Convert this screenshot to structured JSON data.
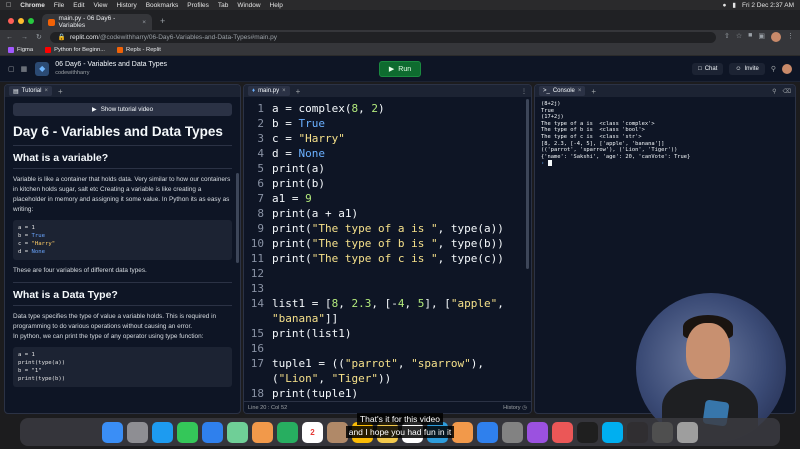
{
  "menubar": {
    "apple": "",
    "app": "Chrome",
    "items": [
      "File",
      "Edit",
      "View",
      "History",
      "Bookmarks",
      "Profiles",
      "Tab",
      "Window",
      "Help"
    ],
    "datetime": "Fri 2 Dec  2:37 AM"
  },
  "browser": {
    "tab_title": "main.py - 06 Day6 - Variables",
    "tab_close": "×",
    "new_tab": "+",
    "url_host": "replit.com",
    "url_path": "/@codewithharry/06-Day6-Variables-and-Data-Types#main.py"
  },
  "bookmarks": [
    {
      "label": "Figma",
      "color": "#a259ff"
    },
    {
      "label": "Python for Beginn...",
      "color": "#ff0000"
    },
    {
      "label": "Repls - Replit",
      "color": "#f26207"
    }
  ],
  "replit": {
    "project_title": "06 Day6 - Variables and Data Types",
    "owner": "codewithharry",
    "run_label": "Run",
    "chat_label": "Chat",
    "invite_label": "Invite"
  },
  "tutorial": {
    "tab_label": "Tutorial",
    "show_video": "Show tutorial video",
    "title": "Day 6 - Variables and Data Types",
    "h_variable": "What is a variable?",
    "p_variable": "Variable is like a container that holds data. Very similar to how our containers in kitchen holds sugar, salt etc Creating a variable is like creating a placeholder in memory and assigning it some value. In Python its as easy as writing:",
    "code1": [
      {
        "a": "a = ",
        "b": "1",
        "t": "num"
      },
      {
        "a": "b = ",
        "b": "True",
        "t": "kw"
      },
      {
        "a": "c = ",
        "b": "\"Harry\"",
        "t": "str"
      },
      {
        "a": "d = ",
        "b": "None",
        "t": "kw"
      }
    ],
    "p_four": "These are four variables of different data types.",
    "h_datatype": "What is a Data Type?",
    "p_datatype": "Data type specifies the type of value a variable holds. This is required in programming to do various operations without causing an error.",
    "p_datatype2": "In python, we can print the type of any operator using type function:",
    "code2": [
      "a = 1",
      "print(type(a))",
      "b = \"1\"",
      "print(type(b))"
    ]
  },
  "editor": {
    "tab_label": "main.py",
    "status_left": "Line 20 : Col 52",
    "status_right": "History",
    "lines": [
      {
        "n": "1",
        "segs": [
          {
            "t": "a = complex(",
            "c": "cl"
          },
          {
            "t": "8",
            "c": "cl-num"
          },
          {
            "t": ", ",
            "c": "cl"
          },
          {
            "t": "2",
            "c": "cl-num"
          },
          {
            "t": ")",
            "c": "cl"
          }
        ]
      },
      {
        "n": "2",
        "segs": [
          {
            "t": "b = ",
            "c": "cl"
          },
          {
            "t": "True",
            "c": "cl-const"
          }
        ]
      },
      {
        "n": "3",
        "segs": [
          {
            "t": "c = ",
            "c": "cl"
          },
          {
            "t": "\"Harry\"",
            "c": "cl-str"
          }
        ]
      },
      {
        "n": "4",
        "segs": [
          {
            "t": "d = ",
            "c": "cl"
          },
          {
            "t": "None",
            "c": "cl-const"
          }
        ]
      },
      {
        "n": "5",
        "segs": [
          {
            "t": "print(a)",
            "c": "cl"
          }
        ]
      },
      {
        "n": "6",
        "segs": [
          {
            "t": "print(b)",
            "c": "cl"
          }
        ]
      },
      {
        "n": "7",
        "segs": [
          {
            "t": "a1 = ",
            "c": "cl"
          },
          {
            "t": "9",
            "c": "cl-num"
          }
        ]
      },
      {
        "n": "8",
        "segs": [
          {
            "t": "print(a + a1)",
            "c": "cl"
          }
        ]
      },
      {
        "n": "9",
        "segs": [
          {
            "t": "print(",
            "c": "cl"
          },
          {
            "t": "\"The type of a is \"",
            "c": "cl-str"
          },
          {
            "t": ", type(a))",
            "c": "cl"
          }
        ]
      },
      {
        "n": "10",
        "segs": [
          {
            "t": "print(",
            "c": "cl"
          },
          {
            "t": "\"The type of b is \"",
            "c": "cl-str"
          },
          {
            "t": ", type(b))",
            "c": "cl"
          }
        ]
      },
      {
        "n": "11",
        "segs": [
          {
            "t": "print(",
            "c": "cl"
          },
          {
            "t": "\"The type of c is \"",
            "c": "cl-str"
          },
          {
            "t": ", type(c))",
            "c": "cl"
          }
        ]
      },
      {
        "n": "12",
        "segs": [
          {
            "t": "",
            "c": "cl"
          }
        ]
      },
      {
        "n": "13",
        "segs": [
          {
            "t": "",
            "c": "cl"
          }
        ]
      },
      {
        "n": "14",
        "segs": [
          {
            "t": "list1 = [",
            "c": "cl"
          },
          {
            "t": "8",
            "c": "cl-num"
          },
          {
            "t": ", ",
            "c": "cl"
          },
          {
            "t": "2.3",
            "c": "cl-num"
          },
          {
            "t": ", [-",
            "c": "cl"
          },
          {
            "t": "4",
            "c": "cl-num"
          },
          {
            "t": ", ",
            "c": "cl"
          },
          {
            "t": "5",
            "c": "cl-num"
          },
          {
            "t": "], [",
            "c": "cl"
          },
          {
            "t": "\"apple\"",
            "c": "cl-str"
          },
          {
            "t": ",",
            "c": "cl"
          }
        ]
      },
      {
        "n": "",
        "segs": [
          {
            "t": "\"banana\"",
            "c": "cl-str"
          },
          {
            "t": "]]",
            "c": "cl"
          }
        ]
      },
      {
        "n": "15",
        "segs": [
          {
            "t": "print(list1)",
            "c": "cl"
          }
        ]
      },
      {
        "n": "16",
        "segs": [
          {
            "t": "",
            "c": "cl"
          }
        ]
      },
      {
        "n": "17",
        "segs": [
          {
            "t": "tuple1 = ((",
            "c": "cl"
          },
          {
            "t": "\"parrot\"",
            "c": "cl-str"
          },
          {
            "t": ", ",
            "c": "cl"
          },
          {
            "t": "\"sparrow\"",
            "c": "cl-str"
          },
          {
            "t": "),",
            "c": "cl"
          }
        ]
      },
      {
        "n": "",
        "segs": [
          {
            "t": "(",
            "c": "cl"
          },
          {
            "t": "\"Lion\"",
            "c": "cl-str"
          },
          {
            "t": ", ",
            "c": "cl"
          },
          {
            "t": "\"Tiger\"",
            "c": "cl-str"
          },
          {
            "t": "))",
            "c": "cl"
          }
        ]
      },
      {
        "n": "18",
        "segs": [
          {
            "t": "print(tuple1)",
            "c": "cl"
          }
        ]
      }
    ]
  },
  "console": {
    "tab_label": "Console",
    "output": [
      "(8+2j)",
      "True",
      "(17+2j)",
      "The type of a is  <class 'complex'>",
      "The type of b is  <class 'bool'>",
      "The type of c is  <class 'str'>",
      "[8, 2.3, [-4, 5], ['apple', 'banana']]",
      "(('parrot', 'sparrow'), ('Lion', 'Tiger'))",
      "{'name': 'Sakshi', 'age': 20, 'canVote': True}"
    ],
    "prompt": "›"
  },
  "caption": {
    "line1": "That's it for this video",
    "line2": "and I hope you had fun in it"
  },
  "dock": {
    "calendar_day": "2",
    "icons": [
      {
        "name": "finder-icon",
        "color": "#3a8ef6"
      },
      {
        "name": "launchpad-icon",
        "color": "#8e8e93"
      },
      {
        "name": "safari-icon",
        "color": "#1d9bf0"
      },
      {
        "name": "messages-icon",
        "color": "#34c759"
      },
      {
        "name": "mail-icon",
        "color": "#2f80ed"
      },
      {
        "name": "maps-icon",
        "color": "#6fcf97"
      },
      {
        "name": "photos-icon",
        "color": "#f2994a"
      },
      {
        "name": "facetime-icon",
        "color": "#27ae60"
      },
      {
        "name": "calendar-icon",
        "color": "#ffffff"
      },
      {
        "name": "contacts-icon",
        "color": "#b08968"
      },
      {
        "name": "chrome-icon",
        "color": "#fbbc05"
      },
      {
        "name": "notes-icon",
        "color": "#f2c94c"
      },
      {
        "name": "reminders-icon",
        "color": "#ffffff"
      },
      {
        "name": "appstore-icon",
        "color": "#2d9cdb"
      },
      {
        "name": "pencil-icon",
        "color": "#f2994a"
      },
      {
        "name": "xcode-icon",
        "color": "#2f80ed"
      },
      {
        "name": "settings-icon",
        "color": "#828282"
      },
      {
        "name": "podcasts-icon",
        "color": "#9b51e0"
      },
      {
        "name": "music-icon",
        "color": "#eb5757"
      },
      {
        "name": "terminal-icon",
        "color": "#1f1f1f"
      },
      {
        "name": "skype-icon",
        "color": "#00aff0"
      },
      {
        "name": "obs-icon",
        "color": "#302e31"
      },
      {
        "name": "screen-icon",
        "color": "#4f4f4f"
      },
      {
        "name": "trash-icon",
        "color": "#9e9e9e"
      }
    ]
  }
}
